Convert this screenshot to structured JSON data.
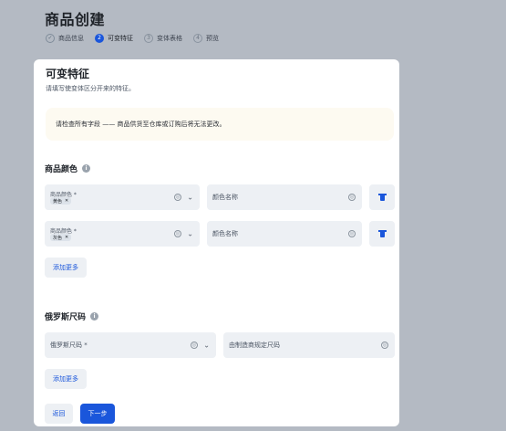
{
  "page": {
    "title": "商品创建"
  },
  "stepper": [
    {
      "num": "✓",
      "label": "商品信息",
      "state": "done"
    },
    {
      "num": "2",
      "label": "可变特征",
      "state": "active"
    },
    {
      "num": "3",
      "label": "变体表格",
      "state": "pending"
    },
    {
      "num": "4",
      "label": "预览",
      "state": "pending"
    }
  ],
  "card": {
    "title": "可变特征",
    "subtitle": "请填写使变体区分开来的特征。",
    "notice": "请检查所有字段 —— 商品供货至仓库或订购后将无法更改。"
  },
  "color_section": {
    "title": "商品颜色",
    "rows": [
      {
        "field_label": "商品颜色 *",
        "tag": "黄色",
        "name_placeholder": "颜色名称"
      },
      {
        "field_label": "商品颜色 *",
        "tag": "灰色",
        "name_placeholder": "颜色名称"
      }
    ],
    "add_more": "添加更多"
  },
  "size_section": {
    "title": "俄罗斯尺码",
    "size_placeholder": "俄罗斯尺码 *",
    "maker_placeholder": "由制造商规定尺码",
    "add_more": "添加更多"
  },
  "footer": {
    "back": "返回",
    "next": "下一步"
  },
  "colors": {
    "accent": "#1a56db",
    "background": "#b4bac3",
    "field": "#edf0f4",
    "notice": "#fdfaf1"
  }
}
